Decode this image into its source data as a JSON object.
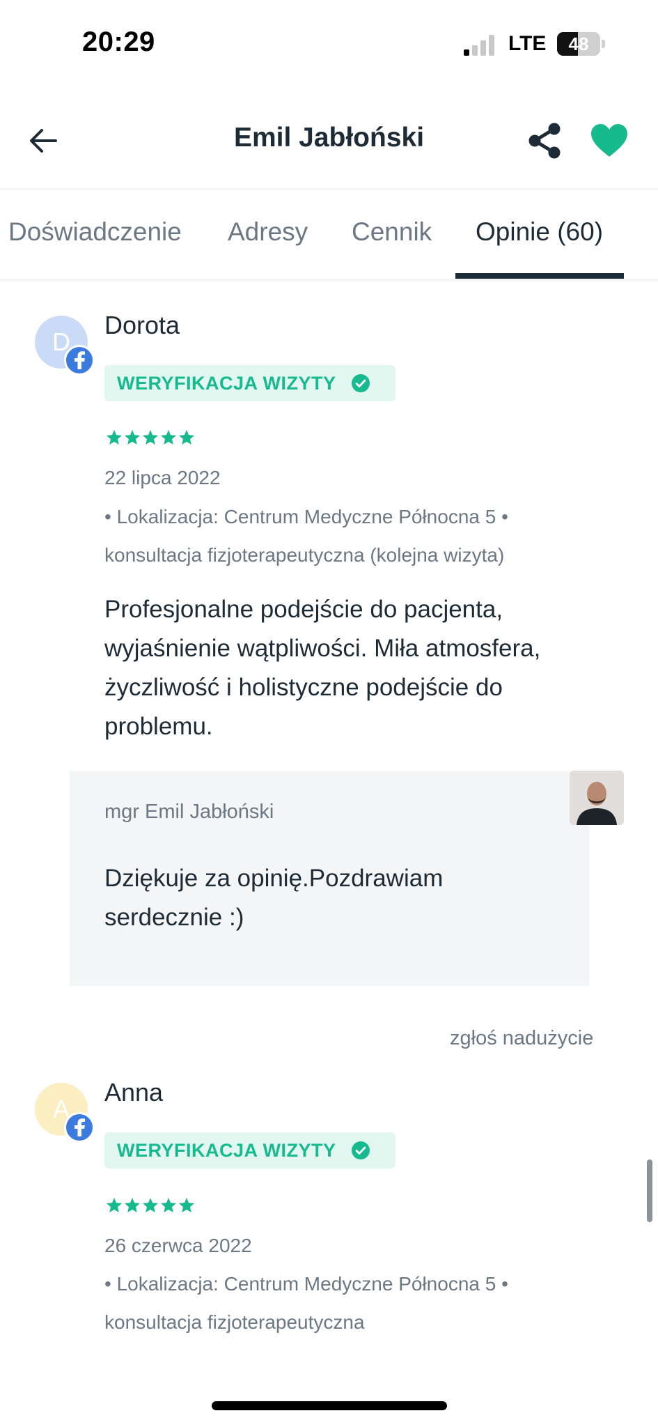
{
  "status_bar": {
    "time": "20:29",
    "network": "LTE",
    "battery": "48",
    "battery_level": 0.48
  },
  "header": {
    "title": "Emil Jabłoński",
    "back_icon": "arrow-left-icon",
    "share_icon": "share-icon",
    "favorite_icon": "heart-icon",
    "accent_color": "#17b98f"
  },
  "tabs": [
    {
      "label": "Doświadczenie",
      "active": false
    },
    {
      "label": "Adresy",
      "active": false
    },
    {
      "label": "Cennik",
      "active": false
    },
    {
      "label": "Opinie (60)",
      "active": true
    }
  ],
  "reviews": [
    {
      "initial": "D",
      "name": "Dorota",
      "avatar_color": "#c9dbf6",
      "badge": "WERYFIKACJA WIZYTY",
      "rating": 5,
      "date": "22 lipca 2022",
      "meta": "• Lokalizacja: Centrum Medyczne Północna 5 • konsultacja fizjoterapeutyczna (kolejna wizyta)",
      "text": "Profesjonalne podejście do pacjenta, wyjaśnienie wątpliwości. Miła atmosfera, życzliwość i holistyczne podejście do problemu.",
      "reply": {
        "author": "mgr Emil Jabłoński",
        "text": "Dziękuje za opinię.Pozdrawiam serdecznie :)"
      },
      "report_label": "zgłoś nadużycie"
    },
    {
      "initial": "A",
      "name": "Anna",
      "avatar_color": "#fbeec0",
      "badge": "WERYFIKACJA WIZYTY",
      "rating": 5,
      "date": "26 czerwca 2022",
      "meta": "• Lokalizacja: Centrum Medyczne Północna 5 • konsultacja fizjoterapeutyczna"
    }
  ]
}
